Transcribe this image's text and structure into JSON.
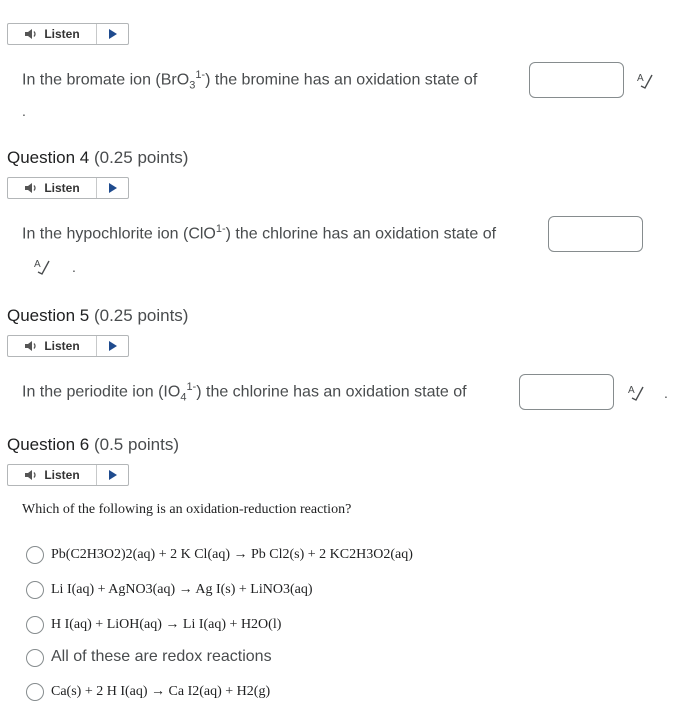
{
  "listen": {
    "label": "Listen"
  },
  "q3": {
    "prefix": "In the bromate ion (BrO",
    "sub": "3",
    "sup": "1-",
    "suffix": ") the bromine has an oxidation state of",
    "trailing": "."
  },
  "q4": {
    "title": "Question 4",
    "points": "(0.25 points)",
    "prefix": "In the hypochlorite ion (ClO",
    "sup": "1-",
    "suffix": ") the chlorine has an oxidation state of",
    "trailing": "."
  },
  "q5": {
    "title": "Question 5",
    "points": "(0.25 points)",
    "prefix": "In the periodite ion (IO",
    "sub": "4",
    "sup": "1-",
    "suffix": ") the chlorine has an oxidation state of",
    "trailing": "."
  },
  "q6": {
    "title": "Question 6",
    "points": "(0.5 points)",
    "prompt": "Which of the following is an oxidation-reduction reaction?",
    "options": [
      "Pb(C2H3O2)2(aq) + 2 K Cl(aq) → Pb Cl2(s) + 2 KC2H3O2(aq)",
      "Li I(aq) + AgNO3(aq) → Ag I(s) + LiNO3(aq)",
      "H I(aq) + LiOH(aq) → Li I(aq) + H2O(l)",
      "All of these are redox reactions",
      "Ca(s) + 2 H I(aq) → Ca I2(aq) + H2(g)"
    ]
  },
  "icons": {
    "speaker": "speaker-icon",
    "play": "play-icon",
    "spellcheck": "spellcheck-icon"
  },
  "colors": {
    "accent": "#1f4b8e",
    "text": "#494c4e",
    "border": "#868c8e"
  }
}
